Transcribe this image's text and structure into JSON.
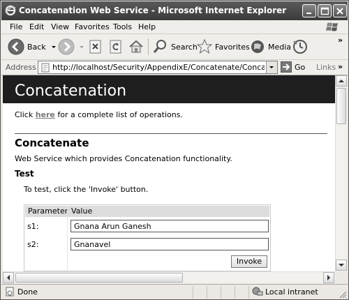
{
  "window": {
    "title": "Concatenation Web Service - Microsoft Internet Explorer"
  },
  "menu": {
    "items": [
      "File",
      "Edit",
      "View",
      "Favorites",
      "Tools",
      "Help"
    ]
  },
  "toolbar": {
    "back_label": "Back",
    "search_label": "Search",
    "favorites_label": "Favorites",
    "media_label": "Media"
  },
  "address": {
    "label": "Address",
    "url": "http://localhost/Security/AppendixE/Concatenate/Concatenate.asmx?op",
    "go_label": "Go",
    "links_label": "Links"
  },
  "page": {
    "heading": "Concatenation",
    "intro_before": "Click ",
    "intro_link": "here",
    "intro_after": " for a complete list of operations.",
    "operation_title": "Concatenate",
    "description": "Web Service which provides Concatenation functionality.",
    "test_title": "Test",
    "test_note": "To test, click the 'Invoke' button.",
    "table": {
      "col_parameter": "Parameter",
      "col_value": "Value",
      "rows": [
        {
          "label": "s1:",
          "value": "Gnana Arun Ganesh"
        },
        {
          "label": "s2:",
          "value": "Gnanavel"
        }
      ]
    },
    "invoke_label": "Invoke"
  },
  "status": {
    "text": "Done",
    "zone": "Local intranet"
  }
}
